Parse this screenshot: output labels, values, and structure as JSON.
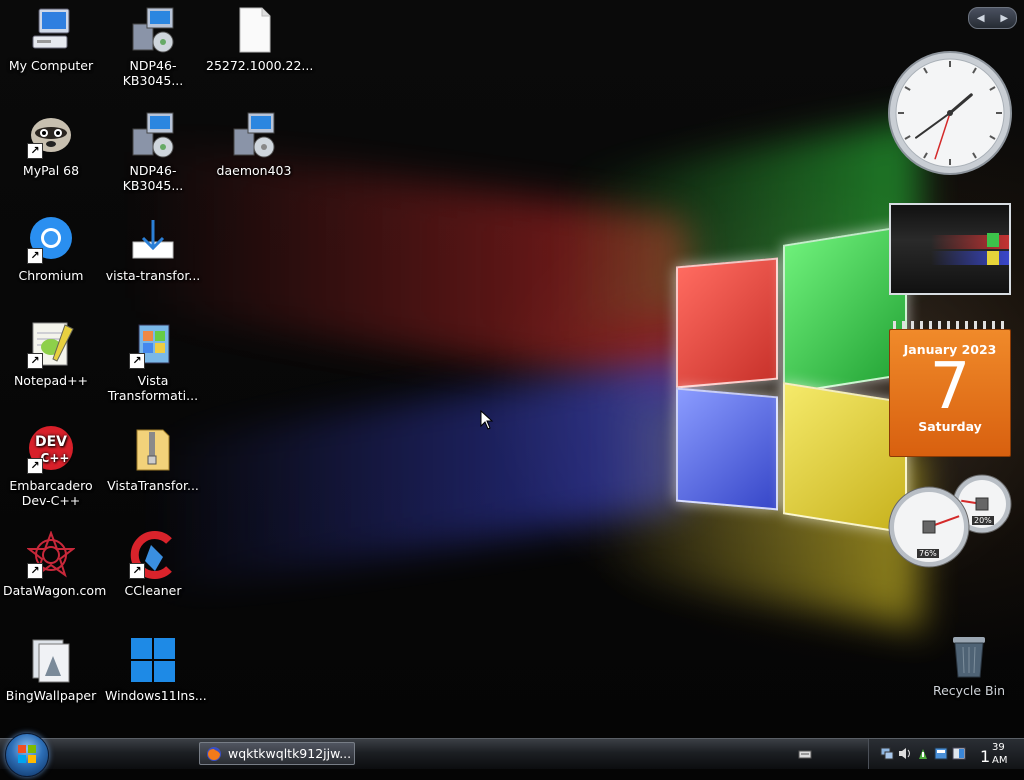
{
  "desktop_icons": [
    {
      "id": "my-computer",
      "label": "My Computer",
      "icon": "computer-icon"
    },
    {
      "id": "ndp46-1",
      "label": "NDP46-KB3045...",
      "icon": "installer-icon"
    },
    {
      "id": "file-25272",
      "label": "25272.1000.22...",
      "icon": "blank-file-icon"
    },
    {
      "id": "mypal",
      "label": "MyPal 68",
      "icon": "raccoon-browser-icon"
    },
    {
      "id": "ndp46-2",
      "label": "NDP46-KB3045...",
      "icon": "installer-icon"
    },
    {
      "id": "daemon403",
      "label": "daemon403",
      "icon": "installer-icon"
    },
    {
      "id": "chromium",
      "label": "Chromium",
      "icon": "chromium-icon"
    },
    {
      "id": "vista-transfor",
      "label": "vista-transfor...",
      "icon": "download-icon"
    },
    {
      "id": "notepadpp",
      "label": "Notepad++",
      "icon": "notepad-icon"
    },
    {
      "id": "vista-transformation",
      "label": "Vista Transformati...",
      "icon": "vista-transform-icon"
    },
    {
      "id": "dev-cpp",
      "label": "Embarcadero Dev-C++",
      "icon": "dev-cpp-icon"
    },
    {
      "id": "vista-zip",
      "label": "VistaTransfor...",
      "icon": "zip-folder-icon"
    },
    {
      "id": "datawagon",
      "label": "DataWagon.com",
      "icon": "datawagon-icon"
    },
    {
      "id": "ccleaner",
      "label": "CCleaner",
      "icon": "ccleaner-icon"
    },
    {
      "id": "bingwallpaper",
      "label": "BingWallpaper",
      "icon": "bing-wallpaper-icon"
    },
    {
      "id": "win11ins",
      "label": "Windows11Ins...",
      "icon": "windows11-icon"
    },
    {
      "id": "recycle",
      "label": "Recycle Bin",
      "icon": "recycle-bin-icon"
    }
  ],
  "gadgets": {
    "calendar": {
      "month_year": "January 2023",
      "day": "7",
      "weekday": "Saturday"
    },
    "cpu_meter": {
      "cpu_percent": "76%",
      "memory_percent": "20%",
      "cpu": 0.76,
      "memory": 0.2
    },
    "clock": {
      "hour": 1,
      "minute": 39,
      "second": 33
    }
  },
  "taskbar": {
    "active_window_title": "wqktkwqltk912jjw...",
    "clock_hour": "1",
    "clock_minute": "39",
    "clock_ampm": "AM"
  },
  "colors": {
    "red": "#e8443a",
    "green": "#3cc24a",
    "blue": "#4a5ce0",
    "yellow": "#e6d43a",
    "calendar_orange": "#e36d15"
  }
}
